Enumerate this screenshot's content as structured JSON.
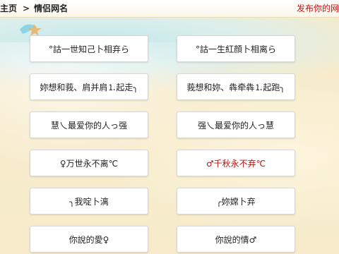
{
  "header": {
    "breadcrumb_home": "主页",
    "breadcrumb_separator": ">",
    "breadcrumb_current": "情侣网名",
    "publish_link": "发布你的网"
  },
  "names": [
    {
      "text": "°詁一世知己卜相弃ら",
      "color": "#222222"
    },
    {
      "text": "°詁一生紅顔卜相离ら",
      "color": "#222222"
    },
    {
      "text": "妳想和莪、肩并肩⒈起走╮",
      "color": "#222222"
    },
    {
      "text": "莪想和妳、犇牵犇⒈起跑╮",
      "color": "#222222"
    },
    {
      "text": "慧乀最爱你的人っ强",
      "color": "#222222"
    },
    {
      "text": "强乀最爱你的人っ慧",
      "color": "#222222"
    },
    {
      "text": "♀万世永不离℃",
      "color": "#222222"
    },
    {
      "text": "♂千秋永不弃℃",
      "color": "#b01212"
    },
    {
      "text": "╮我啶卜漓",
      "color": "#222222"
    },
    {
      "text": "╭妳嫦卜弃",
      "color": "#222222"
    },
    {
      "text": "你說的愛♀",
      "color": "#222222"
    },
    {
      "text": "你說的情♂",
      "color": "#222222"
    }
  ]
}
